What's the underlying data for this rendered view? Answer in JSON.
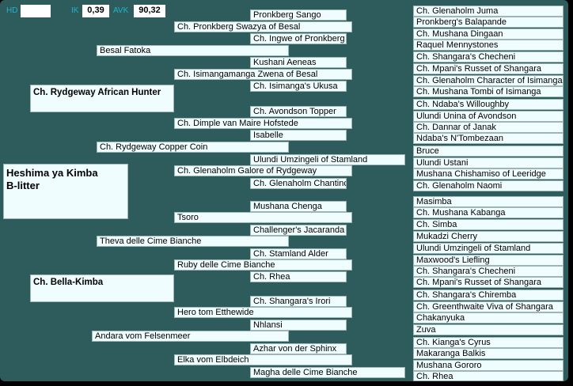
{
  "header": {
    "hd_label": "HD",
    "hd_value": "",
    "ik_label": "IK",
    "ik_value": "0,39",
    "avk_label": "AVK",
    "avk_value": "90,32"
  },
  "subject": {
    "line1": "Heshima ya Kimba",
    "line2": "B-litter"
  },
  "gen1": {
    "sire": "Ch. Rydgeway African Hunter",
    "dam": "Ch. Bella-Kimba"
  },
  "gen2": [
    "Besal Fatoka",
    "Ch. Rydgeway Copper Coin",
    "Theva delle Cime Bianche",
    "Andara vom Felsenmeer"
  ],
  "gen3": [
    "Ch. Pronkberg Swazya of Besal",
    "Ch. Isimangamanga Zwena of Besal",
    "Ch. Dimple van Maire Hofstede",
    "Ch. Glenaholm Galore of Rydgeway",
    "Tsoro",
    "Ruby delle Cime Bianche",
    "Hero tom Etthewide",
    "Elka vom Elbdeich"
  ],
  "gen4": [
    "Pronkberg Sango",
    "Ch. Ingwe of Pronkberg",
    "Kushani Aeneas",
    "Ch. Isimanga's Ukusa",
    "Ch. Avondson Topper",
    "Isabelle",
    "Ulundi Umzingeli of Stamland",
    "Ch. Glenaholm Chantinclear",
    "Mushana Chenga",
    "Challenger's Jacaranda",
    "Ch. Stamland Alder",
    "Ch. Rhea",
    "Ch. Shangara's Irori",
    "Nhlansi",
    "Azhar von der Sphinx",
    "Magha delle Cime Bianche"
  ],
  "gen5": [
    "Ch. Glenaholm Juma",
    "Pronkberg's Balapande",
    "Ch. Mushana Dingaan",
    "Raquel Mennystones",
    "Ch. Shangara's Checheni",
    "Ch. Mpani's Russet of Shangara",
    "Ch. Glenaholm Character of Isimanga",
    "Ch. Mushana Tombi of Isimanga",
    "Ch. Ndaba's Willoughby",
    "Ulundi Unina of Avondson",
    "Ch. Dannar of Janak",
    "Ndaba's N'Tombezaan",
    "Bruce",
    "Ulundi Ustani",
    "Mushana Chishamiso of Leeridge",
    "Ch. Glenaholm Naomi",
    "Masimba",
    "Ch. Mushana Kabanga",
    "Ch. Simba",
    "Mukadzi Cherry",
    "Ulundi Umzingeli of Stamland",
    "Maxwood's Liefling",
    "Ch. Shangara's Checheni",
    "Ch. Mpani's Russet of Shangara",
    "Ch. Shangara's Chiremba",
    "Ch. Greenthwaite Viva of Shangara",
    "Chakanyuka",
    "Zuva",
    "Ch. Kianga's Cyrus",
    "Makaranga Balkis",
    "Mushana Gororo",
    "Ch. Rhea"
  ]
}
